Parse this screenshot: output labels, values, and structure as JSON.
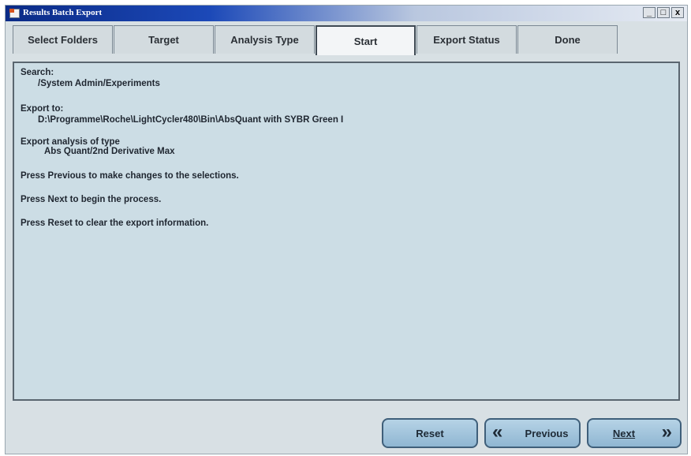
{
  "window": {
    "title": "Results Batch Export",
    "controls": [
      "_",
      "□",
      "x"
    ]
  },
  "tabs": [
    {
      "label": "Select Folders"
    },
    {
      "label": "Target"
    },
    {
      "label": "Analysis Type"
    },
    {
      "label": "Start"
    },
    {
      "label": "Export Status"
    },
    {
      "label": "Done"
    }
  ],
  "content": {
    "search_label": "Search:",
    "search_value": "/System Admin/Experiments",
    "export_to_label": "Export to:",
    "export_to_value": "D:\\Programme\\Roche\\LightCycler480\\Bin\\AbsQuant with SYBR Green I",
    "analysis_label": "Export analysis of type",
    "analysis_value": "Abs Quant/2nd Derivative Max",
    "instr_previous": "Press Previous to make changes to the selections.",
    "instr_next": "Press Next to begin the process.",
    "instr_reset": "Press Reset to clear the export information."
  },
  "buttons": {
    "reset": "Reset",
    "previous": "Previous",
    "next": "Next"
  },
  "icons": {
    "previous": "double-chevron-left-icon",
    "next": "double-chevron-right-icon"
  }
}
